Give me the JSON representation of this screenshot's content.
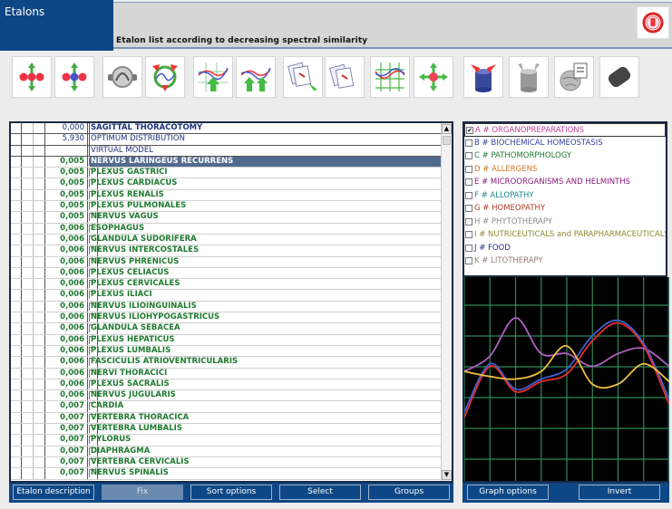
{
  "window": {
    "title": "Etalons",
    "subtitle": "Etalon list according to decreasing spectral similarity",
    "close_icon": "exit-power-icon"
  },
  "toolbar": {
    "buttons": [
      {
        "icon": "molecule-expand-red-icon"
      },
      {
        "icon": "molecule-expand-blue-icon"
      },
      {
        "icon": "sampler-device-icon"
      },
      {
        "icon": "triangle-graph-icon"
      },
      {
        "icon": "graph-up-arrow-icon"
      },
      {
        "icon": "graph-double-up-arrow-icon"
      },
      {
        "icon": "documents-arrow-icon"
      },
      {
        "icon": "documents-icon"
      },
      {
        "icon": "grid-graph-icon"
      },
      {
        "icon": "molecule-expand-single-icon"
      },
      {
        "icon": "cylinder-red-arrows-icon"
      },
      {
        "icon": "cylinder-gray-arrows-icon"
      },
      {
        "icon": "globe-document-icon"
      },
      {
        "icon": "dark-capsule-icon"
      }
    ]
  },
  "list": {
    "header_rows": [
      {
        "value": "0,000",
        "name": "SAGITTAL THORACOTOMY",
        "bold": true
      },
      {
        "value": "5,930",
        "name": "OPTIMUM DISTRIBUTION",
        "bold": false
      },
      {
        "value": "",
        "name": "VIRTUAL MODEL",
        "bold": false
      }
    ],
    "rows": [
      {
        "value": "0,005",
        "name": "NERVUS  LARINGEUS  RECURRENS",
        "selected": true
      },
      {
        "value": "0,005",
        "name": "PLEXUS  GASTRICI"
      },
      {
        "value": "0,005",
        "name": "PLEXUS  CARDIACUS"
      },
      {
        "value": "0,005",
        "name": "PLEXUS  RENALIS"
      },
      {
        "value": "0,005",
        "name": "PLEXUS  PULMONALES"
      },
      {
        "value": "0,005",
        "name": "NERVUS  VAGUS"
      },
      {
        "value": "0,006",
        "name": "ESOPHAGUS"
      },
      {
        "value": "0,006",
        "name": "GLANDULA  SUDORIFERA"
      },
      {
        "value": "0,006",
        "name": "NERVUS  INTERCOSTALES"
      },
      {
        "value": "0,006",
        "name": "NERVUS  PHRENICUS"
      },
      {
        "value": "0,006",
        "name": "PLEXUS  CELIACUS"
      },
      {
        "value": "0,006",
        "name": "PLEXUS  CERVICALES"
      },
      {
        "value": "0,006",
        "name": "PLEXUS  ILIACI"
      },
      {
        "value": "0,006",
        "name": "NERVUS  ILIOINGUINALIS"
      },
      {
        "value": "0,006",
        "name": "NERVUS  ILIOHYPOGASTRICUS"
      },
      {
        "value": "0,006",
        "name": "GLANDULA  SEBACEA"
      },
      {
        "value": "0,006",
        "name": "PLEXUS  HEPATICUS"
      },
      {
        "value": "0,006",
        "name": "PLEXUS  LUMBALIS"
      },
      {
        "value": "0,006",
        "name": "FASCICULIS  ATRIOVENTRICULARIS"
      },
      {
        "value": "0,006",
        "name": "NERVI  THORACICI"
      },
      {
        "value": "0,006",
        "name": "PLEXUS  SACRALIS"
      },
      {
        "value": "0,006",
        "name": "NERVUS  JUGULARIS"
      },
      {
        "value": "0,007",
        "name": "CARDIA"
      },
      {
        "value": "0,007",
        "name": "VERTEBRA  THORACICA"
      },
      {
        "value": "0,007",
        "name": "VERTEBRA  LUMBALIS"
      },
      {
        "value": "0,007",
        "name": "PYLORUS"
      },
      {
        "value": "0,007",
        "name": "DIAPHRAGMA"
      },
      {
        "value": "0,007",
        "name": "VERTEBRA  CERVICALIS"
      },
      {
        "value": "0,007",
        "name": "NERVUS  SPINALIS"
      }
    ]
  },
  "list_buttons": {
    "etalon_description": "Etalon description",
    "fix": "Fix",
    "sort_options": "Sort options",
    "select": "Select",
    "groups": "Groups"
  },
  "groups": {
    "items": [
      {
        "label": "A # ORGANOPREPARATIONS",
        "checked": true,
        "color": "#c0409a"
      },
      {
        "label": "B # BIOCHEMICAL HOMEOSTASIS",
        "checked": false,
        "color": "#3a3f9a"
      },
      {
        "label": "C # PATHOMORPHOLOGY",
        "checked": false,
        "color": "#1e7a2e"
      },
      {
        "label": "D # ALLERGENS",
        "checked": false,
        "color": "#d07820"
      },
      {
        "label": "E # MICROORGANISMS AND HELMINTHS",
        "checked": false,
        "color": "#8a1a7a"
      },
      {
        "label": "F # ALLOPATHY",
        "checked": false,
        "color": "#1a8a8a"
      },
      {
        "label": "G # HOMEOPATHY",
        "checked": false,
        "color": "#b03a2a"
      },
      {
        "label": "H # PHYTOTHERAPY",
        "checked": false,
        "color": "#8a8a8a"
      },
      {
        "label": "I # NUTRICEUTICALS and PARAPHARMACEUTICALS",
        "checked": false,
        "color": "#8a8a30"
      },
      {
        "label": "J # FOOD",
        "checked": false,
        "color": "#2a2a8a"
      },
      {
        "label": "K # LITOTHERAPY",
        "checked": false,
        "color": "#9a7a7a"
      }
    ]
  },
  "graph_buttons": {
    "graph_options": "Graph options",
    "invert": "Invert"
  },
  "chart_data": {
    "type": "line",
    "title": "",
    "xlabel": "",
    "ylabel": "",
    "grid": true,
    "x": [
      0,
      1,
      2,
      3,
      4,
      5,
      6,
      7,
      8
    ],
    "xlim": [
      0,
      8
    ],
    "ylim": [
      0,
      8
    ],
    "series": [
      {
        "name": "purple",
        "color": "#b060c0",
        "values": [
          4.3,
          4.9,
          6.4,
          5.0,
          5.0,
          4.5,
          5.0,
          5.2,
          4.5
        ]
      },
      {
        "name": "blue",
        "color": "#4060d0",
        "values": [
          2.7,
          4.6,
          3.6,
          4.0,
          4.4,
          5.7,
          6.3,
          5.4,
          3.2
        ]
      },
      {
        "name": "red",
        "color": "#e03030",
        "values": [
          2.5,
          4.5,
          3.5,
          3.9,
          4.2,
          5.5,
          6.2,
          5.3,
          3.0
        ]
      },
      {
        "name": "yellow",
        "color": "#f0c040",
        "values": [
          4.3,
          4.1,
          4.0,
          4.3,
          5.3,
          3.8,
          3.8,
          4.6,
          3.9
        ]
      }
    ]
  }
}
